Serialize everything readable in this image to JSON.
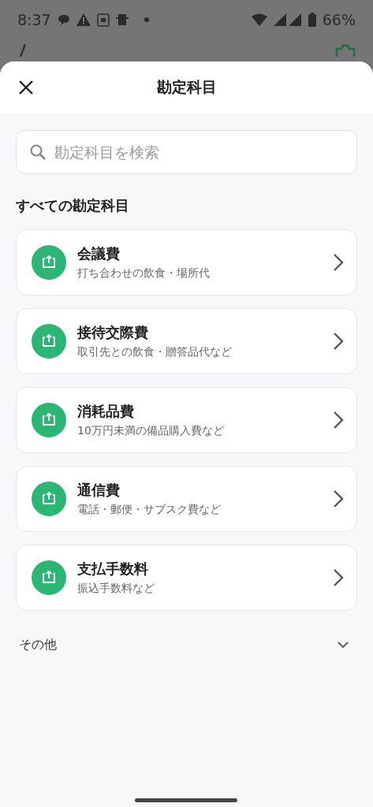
{
  "status_bar": {
    "time": "8:37",
    "battery": "66%"
  },
  "sheet": {
    "title": "勘定科目"
  },
  "search": {
    "placeholder": "勘定科目を検索"
  },
  "section_title": "すべての勘定科目",
  "accounts": [
    {
      "name": "会議費",
      "description": "打ち合わせの飲食・場所代"
    },
    {
      "name": "接待交際費",
      "description": "取引先との飲食・贈答品代など"
    },
    {
      "name": "消耗品費",
      "description": "10万円未満の備品購入費など"
    },
    {
      "name": "通信費",
      "description": "電話・郵便・サブスク費など"
    },
    {
      "name": "支払手数料",
      "description": "振込手数料など"
    }
  ],
  "other": {
    "label": "その他",
    "expanded": false
  }
}
